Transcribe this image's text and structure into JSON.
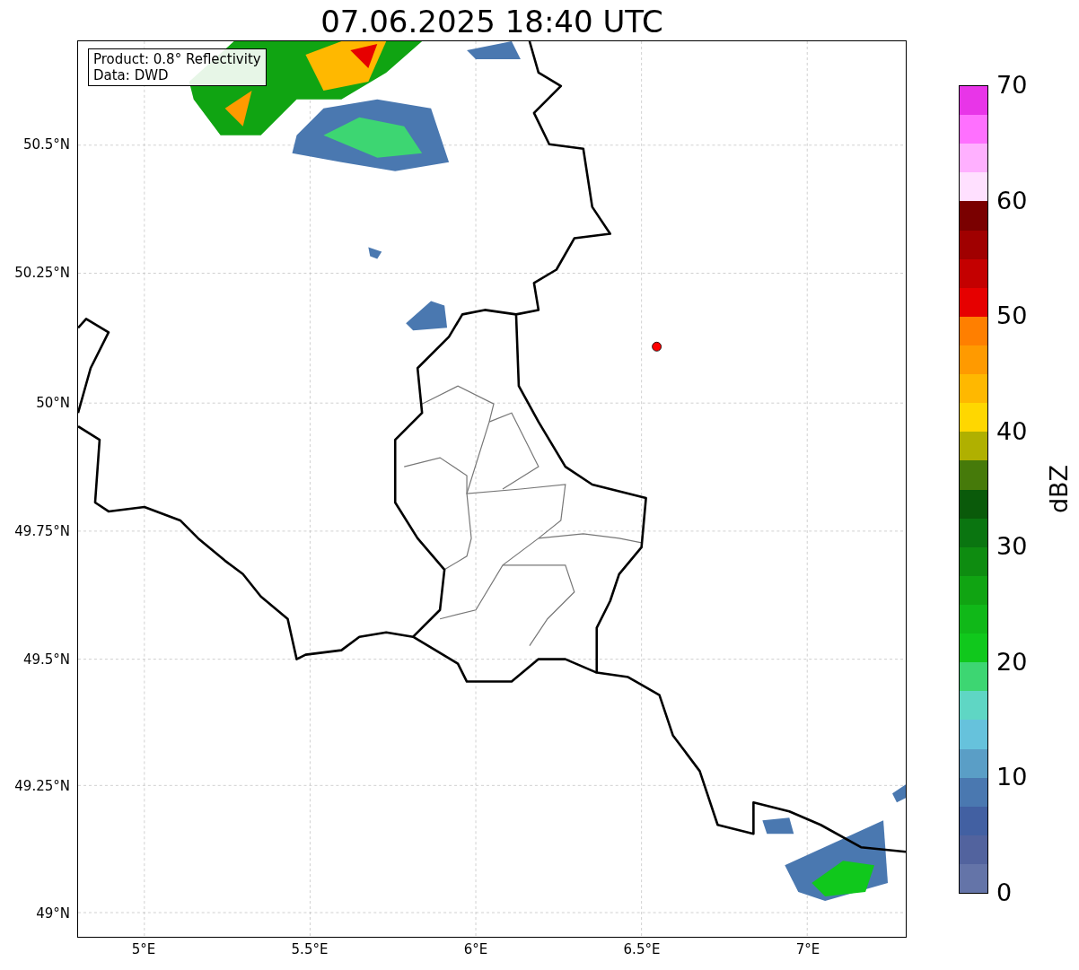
{
  "title": "07.06.2025 18:40 UTC",
  "info_box": [
    "Product: 0.8° Reflectivity",
    "Data: DWD"
  ],
  "y_ticks": [
    "50.5°N",
    "50.25°N",
    "50°N",
    "49.75°N",
    "49.5°N",
    "49.25°N",
    "49°N"
  ],
  "x_ticks": [
    "5°E",
    "5.5°E",
    "6°E",
    "6.5°E",
    "7°E"
  ],
  "colorbar": {
    "label": "dBZ",
    "ticks": [
      "70",
      "60",
      "50",
      "40",
      "30",
      "20",
      "10",
      "0"
    ],
    "segments": [
      {
        "color": "#e835e8"
      },
      {
        "color": "#ff70ff"
      },
      {
        "color": "#ffb0ff"
      },
      {
        "color": "#ffe0ff"
      },
      {
        "color": "#7a0000"
      },
      {
        "color": "#a00000"
      },
      {
        "color": "#c40000"
      },
      {
        "color": "#e60000"
      },
      {
        "color": "#ff7f00"
      },
      {
        "color": "#ff9a00"
      },
      {
        "color": "#ffb800"
      },
      {
        "color": "#ffd700"
      },
      {
        "color": "#b0b000"
      },
      {
        "color": "#467a0a"
      },
      {
        "color": "#0a5a0a"
      },
      {
        "color": "#0a7510"
      },
      {
        "color": "#0e8c10"
      },
      {
        "color": "#10a412"
      },
      {
        "color": "#10b818"
      },
      {
        "color": "#10c81c"
      },
      {
        "color": "#3dd672"
      },
      {
        "color": "#5fd6c4"
      },
      {
        "color": "#66c2dc"
      },
      {
        "color": "#5a9ec6"
      },
      {
        "color": "#4a78b0"
      },
      {
        "color": "#4260a2"
      },
      {
        "color": "#52639e"
      },
      {
        "color": "#6474a8"
      }
    ]
  }
}
